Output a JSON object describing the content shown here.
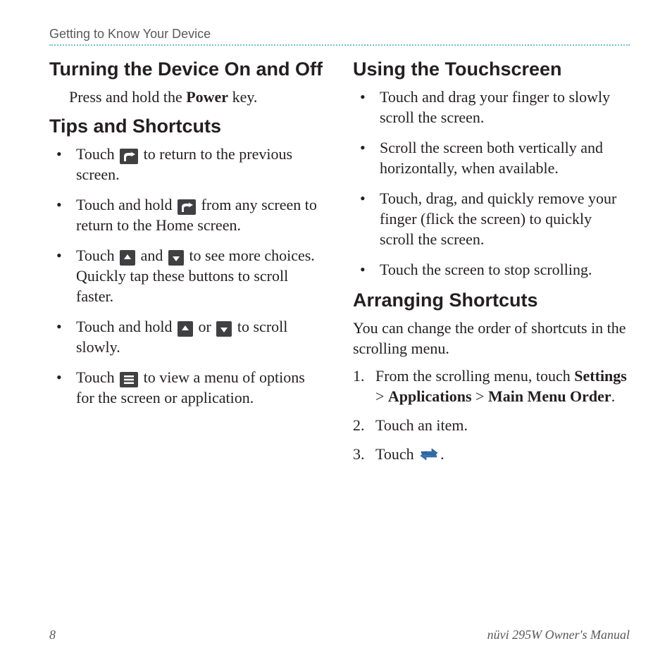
{
  "header": {
    "chapter": "Getting to Know Your Device"
  },
  "footer": {
    "page": "8",
    "manual": "nüvi 295W Owner's Manual"
  },
  "left": {
    "h1": "Turning the Device On and Off",
    "s1_pre": "Press and hold the ",
    "s1_bold": "Power",
    "s1_post": " key.",
    "h2": "Tips and Shortcuts",
    "tips": {
      "t1_pre": "Touch ",
      "t1_post": " to return to the previous screen.",
      "t2_pre": "Touch and hold ",
      "t2_post": " from any screen to return to the Home screen.",
      "t3_pre": "Touch ",
      "t3_mid": " and ",
      "t3_post": " to see more choices. Quickly tap these buttons to scroll faster.",
      "t4_pre": "Touch and hold ",
      "t4_mid": " or ",
      "t4_post": " to scroll slowly.",
      "t5_pre": "Touch ",
      "t5_post": " to view a menu of options for the screen or application."
    }
  },
  "right": {
    "h1": "Using the Touchscreen",
    "ts": {
      "b1": "Touch and drag your finger to slowly scroll the screen.",
      "b2": "Scroll the screen both vertically and horizontally, when available.",
      "b3": "Touch, drag, and quickly remove your finger (flick the screen) to quickly scroll the screen.",
      "b4": "Touch the screen to stop scrolling."
    },
    "h2": "Arranging Shortcuts",
    "intro": "You can change the order of shortcuts in the scrolling menu.",
    "steps": {
      "s1_pre": "From the scrolling menu, touch ",
      "s1_b1": "Settings",
      "s1_sep1": " > ",
      "s1_b2": "Applications",
      "s1_sep2": " > ",
      "s1_b3": "Main Menu Order",
      "s1_post": ".",
      "s2": "Touch an item.",
      "s3_pre": "Touch ",
      "s3_post": "."
    }
  },
  "icons": {
    "back": "back-arrow-icon",
    "up": "scroll-up-icon",
    "down": "scroll-down-icon",
    "menu": "menu-icon",
    "swap": "swap-arrows-icon"
  }
}
